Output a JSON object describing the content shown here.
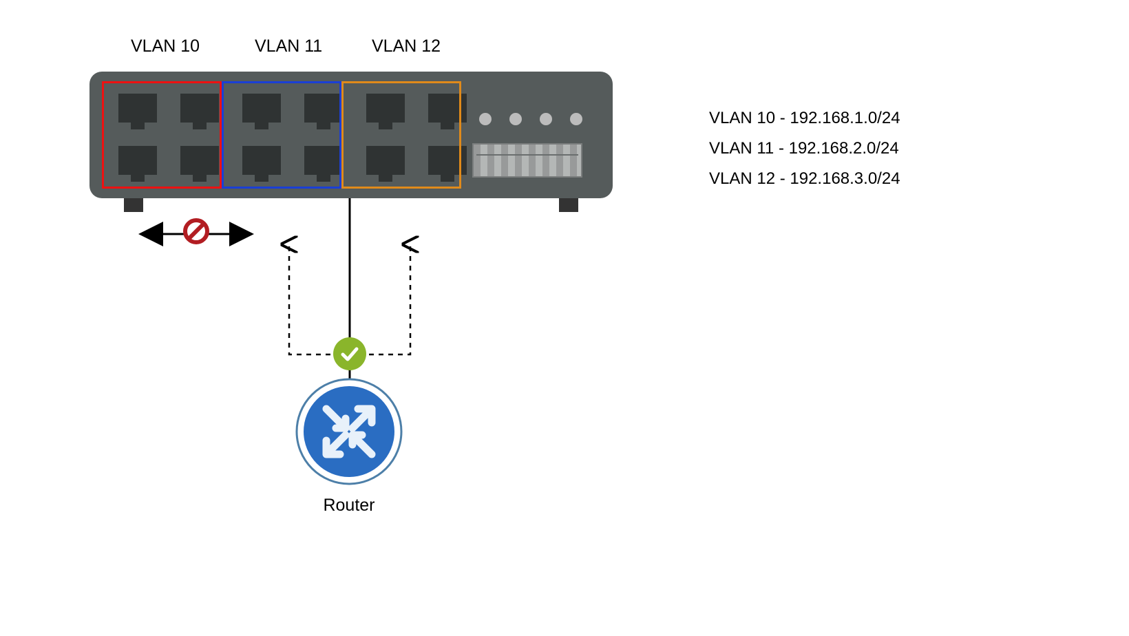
{
  "vlan_labels": {
    "v10": "VLAN 10",
    "v11": "VLAN 11",
    "v12": "VLAN 12"
  },
  "vlan_groups": [
    {
      "id": "vlan10",
      "name": "VLAN 10",
      "subnet": "192.168.1.0/24",
      "color": "#e11111",
      "ports": [
        1,
        2,
        3,
        4
      ]
    },
    {
      "id": "vlan11",
      "name": "VLAN 11",
      "subnet": "192.168.2.0/24",
      "color": "#1a3fd6",
      "ports": [
        5,
        6,
        7,
        8
      ]
    },
    {
      "id": "vlan12",
      "name": "VLAN 12",
      "subnet": "192.168.3.0/24",
      "color": "#e08a1a",
      "ports": [
        9,
        10,
        11,
        12
      ]
    }
  ],
  "legend": {
    "line1": "VLAN 10 - 192.168.1.0/24",
    "line2": "VLAN 11 - 192.168.2.0/24",
    "line3": "VLAN 12 - 192.168.3.0/24"
  },
  "router_label": "Router",
  "semantics": {
    "blocked_direct_intervlan_traffic": true,
    "intervlan_routing_via_router": true
  },
  "icons": {
    "router": "router-icon",
    "check": "check-icon",
    "prohibit": "no-entry-icon"
  },
  "colors": {
    "switch_body": "#555b5b",
    "port": "#2f3333",
    "router_blue": "#2a6dc2",
    "accept_green": "#8ab52b",
    "prohibit_red": "#b21d22"
  }
}
